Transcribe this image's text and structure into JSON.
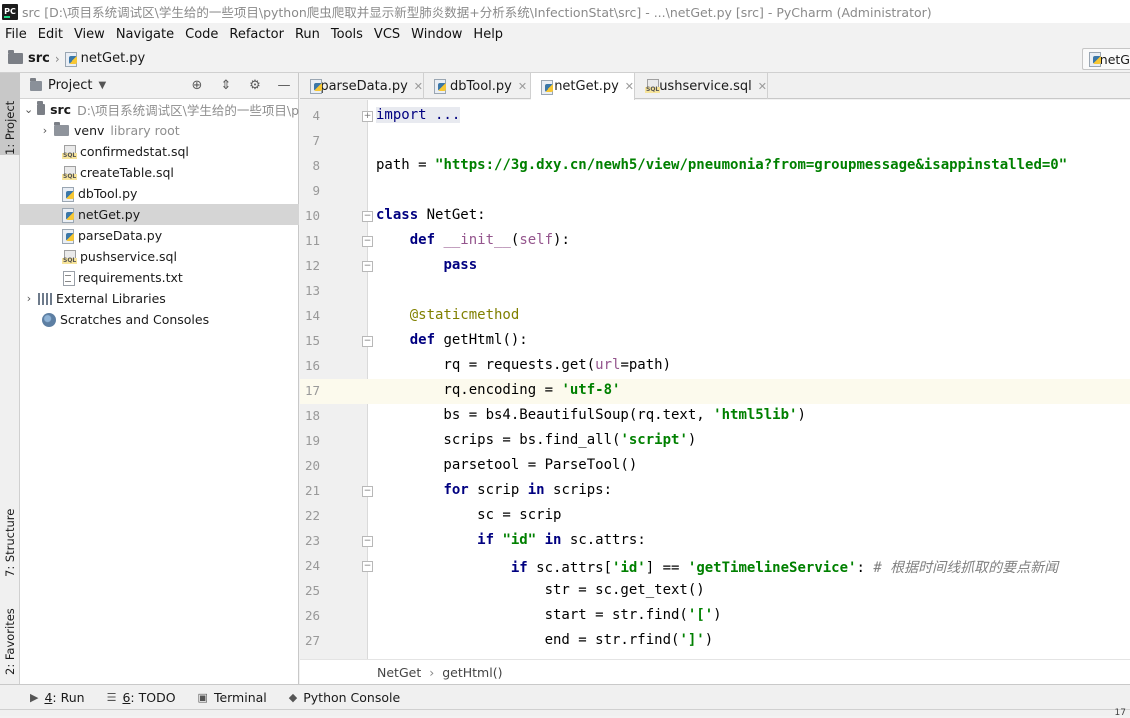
{
  "window": {
    "title": "src [D:\\项目系统调试区\\学生给的一些项目\\python爬虫爬取并显示新型肺炎数据+分析系统\\InfectionStat\\src] - ...\\netGet.py [src] - PyCharm (Administrator)",
    "logo_text": "PC"
  },
  "menu": [
    "File",
    "Edit",
    "View",
    "Navigate",
    "Code",
    "Refactor",
    "Run",
    "Tools",
    "VCS",
    "Window",
    "Help"
  ],
  "navbar": {
    "crumbs": [
      "src",
      "netGet.py"
    ],
    "right_partial": "netG"
  },
  "left_stripe": {
    "project": "1: Project",
    "structure": "7: Structure",
    "favorites": "2: Favorites"
  },
  "project_panel": {
    "title": "Project",
    "root_name": "src",
    "root_path": "D:\\项目系统调试区\\学生给的一些项目\\p",
    "venv": "venv",
    "venv_note": "library root",
    "files": [
      "confirmedstat.sql",
      "createTable.sql",
      "dbTool.py",
      "netGet.py",
      "parseData.py",
      "pushservice.sql",
      "requirements.txt"
    ],
    "external": "External Libraries",
    "scratches": "Scratches and Consoles"
  },
  "tabs": [
    "parseData.py",
    "dbTool.py",
    "netGet.py",
    "pushservice.sql"
  ],
  "code": {
    "line_numbers": [
      "4",
      "7",
      "8",
      "9",
      "10",
      "11",
      "12",
      "13",
      "14",
      "15",
      "16",
      "17",
      "18",
      "19",
      "20",
      "21",
      "22",
      "23",
      "24",
      "25",
      "26",
      "27"
    ],
    "import_folded": "import ...",
    "path_url": "\"https://3g.dxy.cn/newh5/view/pneumonia?from=groupmessage&isappinstalled=0\"",
    "comment_cn": "# 根据时间线抓取的要点新闻"
  },
  "breadcrumb_bottom": [
    "NetGet",
    "getHtml()"
  ],
  "bottom_tools": [
    {
      "num": "4",
      "label": ": Run"
    },
    {
      "num": "6",
      "label": ": TODO"
    },
    {
      "num": "",
      "label": "Terminal"
    },
    {
      "num": "",
      "label": "Python Console"
    }
  ],
  "status_tail": "17"
}
